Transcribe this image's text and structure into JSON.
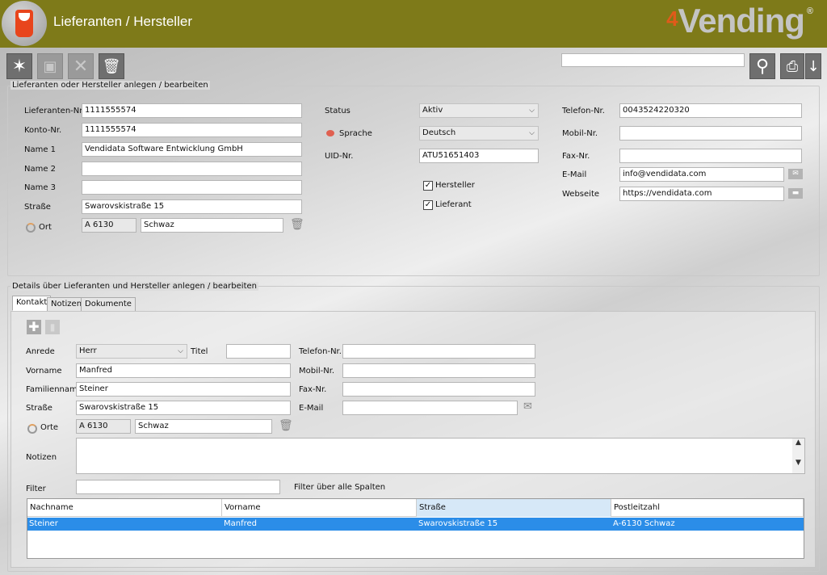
{
  "header": {
    "title": "Lieferanten / Hersteller",
    "brand_num": "4",
    "brand_name": "Vending",
    "brand_reg": "®"
  },
  "toolbar": {
    "new_icon": "star-burst-icon",
    "save_icon": "floppy-disk-icon",
    "cancel_icon": "x-icon",
    "delete_icon": "trash-icon",
    "search_value": "",
    "search_icon": "magnifier-icon",
    "print_icon": "printer-icon",
    "sort_icon": "sort-arrow-icon"
  },
  "supplier": {
    "group_title": "Lieferanten oder Hersteller anlegen / bearbeiten",
    "lieferanten_nr_label": "Lieferanten-Nr.",
    "lieferanten_nr": "1111555574",
    "konto_nr_label": "Konto-Nr.",
    "konto_nr": "1111555574",
    "name1_label": "Name 1",
    "name1": "Vendidata Software Entwicklung GmbH",
    "name2_label": "Name 2",
    "name2": "",
    "name3_label": "Name 3",
    "name3": "",
    "strasse_label": "Straße",
    "strasse": "Swarovskistraße 15",
    "ort_label": "Ort",
    "plz": "A 6130",
    "ort": "Schwaz",
    "status_label": "Status",
    "status": "Aktiv",
    "sprache_label": "Sprache",
    "sprache": "Deutsch",
    "uid_label": "UID-Nr.",
    "uid": "ATU51651403",
    "hersteller_label": "Hersteller",
    "hersteller_checked": true,
    "lieferant_label": "Lieferant",
    "lieferant_checked": true,
    "telefon_label": "Telefon-Nr.",
    "telefon": "0043524220320",
    "mobil_label": "Mobil-Nr.",
    "mobil": "",
    "fax_label": "Fax-Nr.",
    "fax": "",
    "email_label": "E-Mail",
    "email": "info@vendidata.com",
    "webseite_label": "Webseite",
    "webseite": "https://vendidata.com",
    "check_mark": "✓"
  },
  "details": {
    "group_title": "Details über Lieferanten und Hersteller anlegen / bearbeiten",
    "tabs": [
      {
        "label": "Kontakt"
      },
      {
        "label": "Notizen"
      },
      {
        "label": "Dokumente"
      }
    ],
    "anrede_label": "Anrede",
    "anrede": "Herr",
    "titel_label": "Titel",
    "titel": "",
    "vorname_label": "Vorname",
    "vorname": "Manfred",
    "familienname_label": "Familienname",
    "familienname": "Steiner",
    "strasse_label": "Straße",
    "strasse": "Swarovskistraße 15",
    "orte_label": "Orte",
    "plz": "A 6130",
    "ort": "Schwaz",
    "telefon_label": "Telefon-Nr.",
    "telefon": "",
    "mobil_label": "Mobil-Nr.",
    "mobil": "",
    "fax_label": "Fax-Nr.",
    "fax": "",
    "email_label": "E-Mail",
    "email": "",
    "notizen_label": "Notizen",
    "notizen": "",
    "filter_label": "Filter",
    "filter": "",
    "filter_hint": "Filter über alle Spalten",
    "columns": [
      "Nachname",
      "Vorname",
      "Straße",
      "Postleitzahl"
    ],
    "rows": [
      [
        "Steiner",
        "Manfred",
        "Swarovskistraße 15",
        "A-6130 Schwaz"
      ]
    ]
  },
  "colors": {
    "header_bg": "#7e7a19",
    "selection": "#2b8de8",
    "brand_accent": "#e05a1a"
  }
}
